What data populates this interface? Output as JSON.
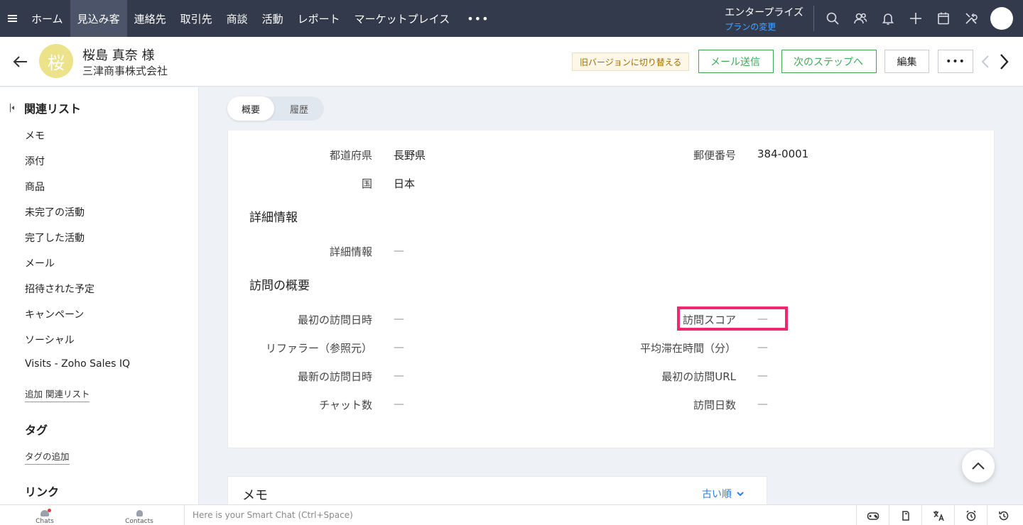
{
  "topnav": {
    "menu_icon": "hamburger-icon",
    "items": [
      "ホーム",
      "見込み客",
      "連絡先",
      "取引先",
      "商談",
      "活動",
      "レポート",
      "マーケットプレイス"
    ],
    "active_index": 1,
    "more": "•••",
    "edition_name": "エンタープライズ",
    "edition_link": "プランの変更",
    "icons": [
      "search-icon",
      "users-icon",
      "bell-icon",
      "plus-icon",
      "calendar-icon",
      "tools-icon",
      "avatar"
    ]
  },
  "record": {
    "avatar_char": "桜",
    "name": "桜島 真奈 様",
    "company": "三津商事株式会社",
    "old_version": "旧バージョンに切り替える",
    "send_mail": "メール送信",
    "next_step": "次のステップへ",
    "edit": "編集",
    "more": "•••"
  },
  "sidebar": {
    "header": "関連リスト",
    "items": [
      "メモ",
      "添付",
      "商品",
      "未完了の活動",
      "完了した活動",
      "メール",
      "招待された予定",
      "キャンペーン",
      "ソーシャル",
      "Visits - Zoho Sales IQ"
    ],
    "add_related": "追加 関連リスト",
    "tags_title": "タグ",
    "add_tag": "タグの追加",
    "links_title": "リンク"
  },
  "tabs": {
    "overview": "概要",
    "history": "履歴"
  },
  "details": {
    "prefecture_label": "都道府県",
    "prefecture_value": "長野県",
    "postal_label": "郵便番号",
    "postal_value": "384-0001",
    "country_label": "国",
    "country_value": "日本",
    "section_detail": "詳細情報",
    "detail_label": "詳細情報",
    "detail_value": "—",
    "section_visit": "訪問の概要",
    "first_visit_label": "最初の訪問日時",
    "first_visit_value": "—",
    "visit_score_label": "訪問スコア",
    "visit_score_value": "—",
    "referrer_label": "リファラー（参照元）",
    "referrer_value": "—",
    "avg_time_label": "平均滞在時間（分）",
    "avg_time_value": "—",
    "latest_visit_label": "最新の訪問日時",
    "latest_visit_value": "—",
    "first_url_label": "最初の訪問URL",
    "first_url_value": "—",
    "chats_label": "チャット数",
    "chats_value": "—",
    "visit_days_label": "訪問日数",
    "visit_days_value": "—"
  },
  "memo": {
    "title": "メモ",
    "sort": "古い順"
  },
  "bottombar": {
    "chats": "Chats",
    "contacts": "Contacts",
    "smart_chat_placeholder": "Here is your Smart Chat (Ctrl+Space)",
    "tools": [
      "gamepad-icon",
      "note-icon",
      "translate-icon",
      "alarm-icon",
      "history-icon"
    ]
  },
  "colors": {
    "topnav": "#323a4b",
    "accent_green": "#3fa95a",
    "highlight": "#f0266f",
    "link_blue": "#2a7de1"
  }
}
